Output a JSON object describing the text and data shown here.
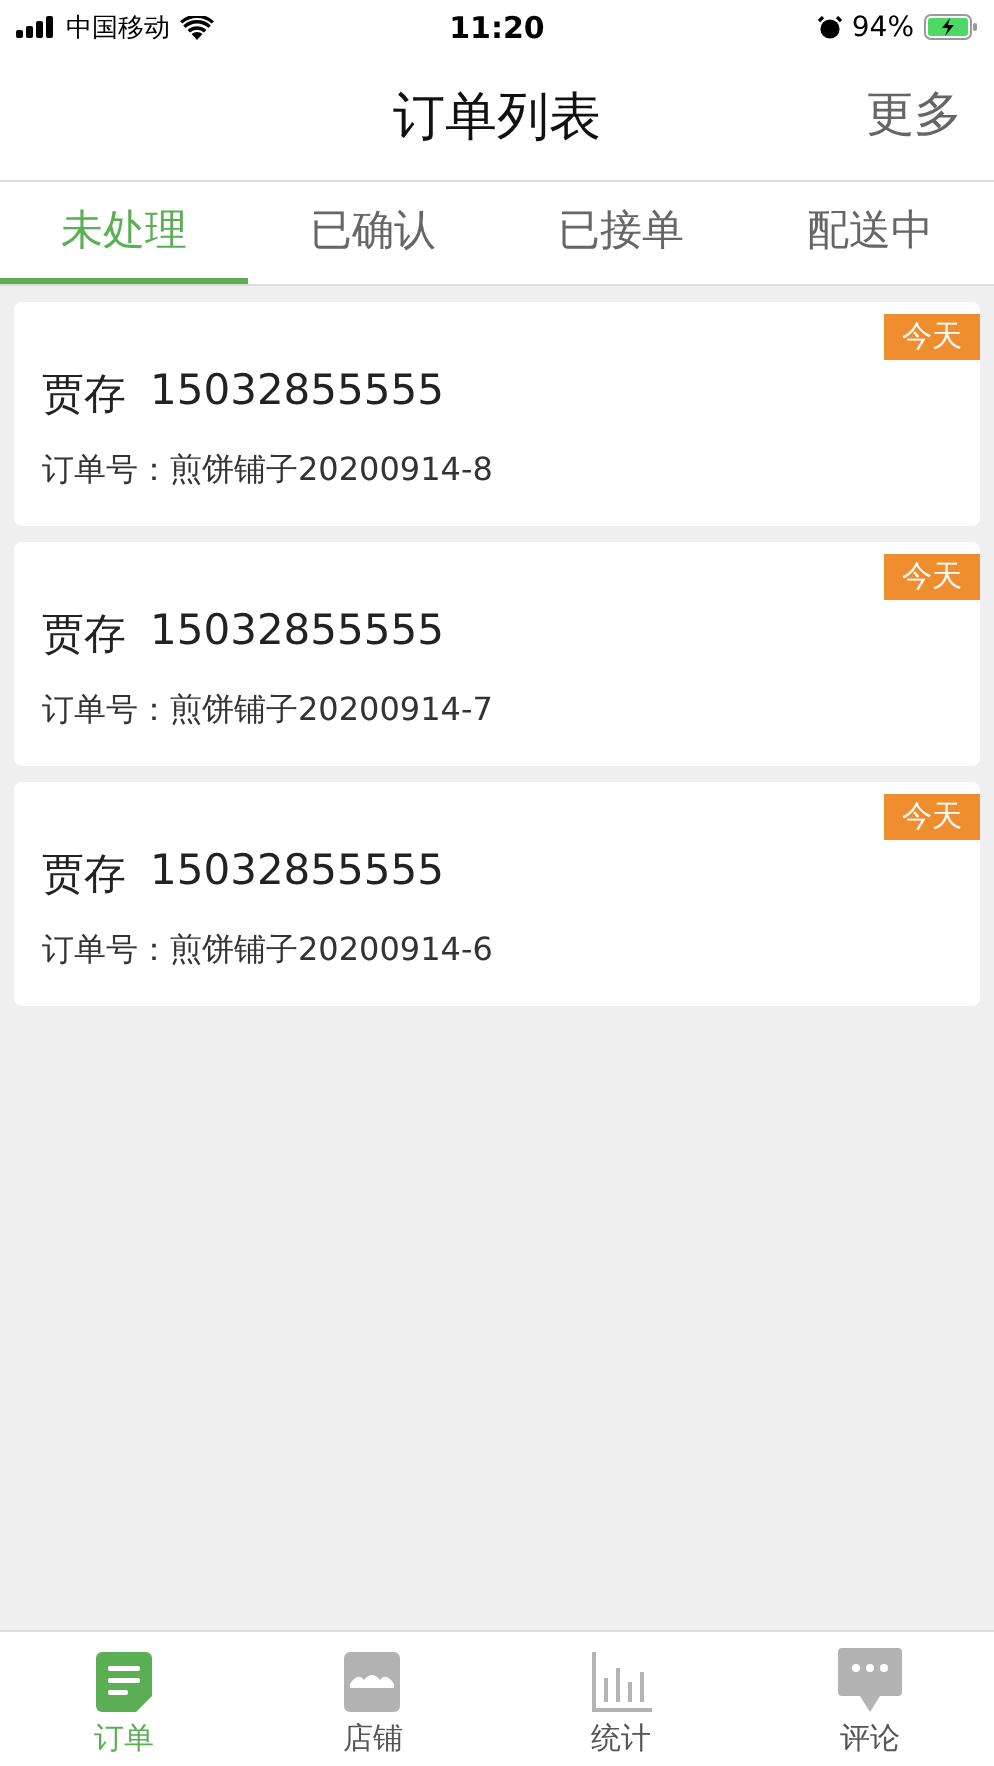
{
  "status_bar": {
    "carrier": "中国移动",
    "time": "11:20",
    "battery": "94%"
  },
  "header": {
    "title": "订单列表",
    "action": "更多"
  },
  "tabs": [
    {
      "label": "未处理",
      "selected": true
    },
    {
      "label": "已确认",
      "selected": false
    },
    {
      "label": "已接单",
      "selected": false
    },
    {
      "label": "配送中",
      "selected": false
    }
  ],
  "orders": [
    {
      "name": "贾存",
      "phone": "15032855555",
      "order_no": "订单号：煎饼铺子20200914-8",
      "badge": "今天"
    },
    {
      "name": "贾存",
      "phone": "15032855555",
      "order_no": "订单号：煎饼铺子20200914-7",
      "badge": "今天"
    },
    {
      "name": "贾存",
      "phone": "15032855555",
      "order_no": "订单号：煎饼铺子20200914-6",
      "badge": "今天"
    }
  ],
  "bottom_nav": [
    {
      "label": "订单",
      "kind": "orders",
      "selected": true
    },
    {
      "label": "店铺",
      "kind": "shop",
      "selected": false
    },
    {
      "label": "统计",
      "kind": "stats",
      "selected": false
    },
    {
      "label": "评论",
      "kind": "comments",
      "selected": false
    }
  ]
}
